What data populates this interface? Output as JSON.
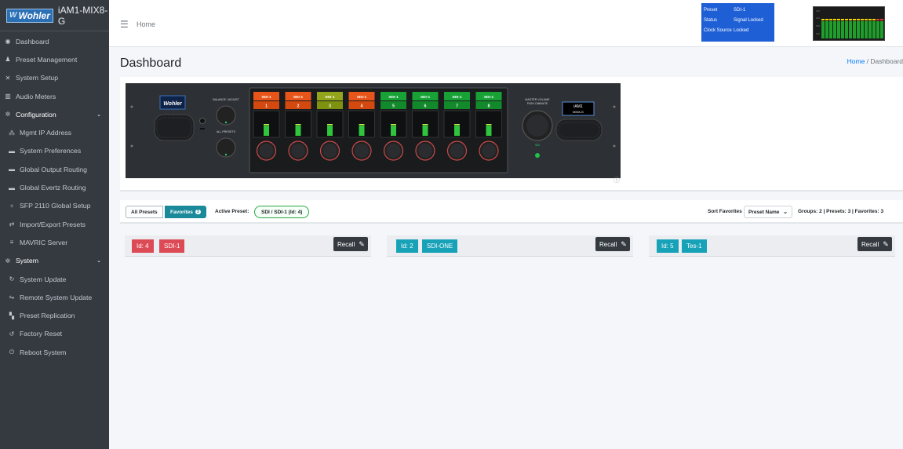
{
  "brand": {
    "logo_text": "Wohler",
    "device_name": "iAM1-MIX8-G"
  },
  "sidebar": {
    "items": [
      {
        "label": "Dashboard",
        "icon": "dashboard-icon",
        "glyph": "◉"
      },
      {
        "label": "Preset Management",
        "icon": "user-settings-icon",
        "glyph": "♟"
      },
      {
        "label": "System Setup",
        "icon": "tools-icon",
        "glyph": "✕"
      },
      {
        "label": "Audio Meters",
        "icon": "chart-icon",
        "glyph": "▥"
      },
      {
        "label": "Configuration",
        "icon": "gear-icon",
        "glyph": "✲"
      },
      {
        "label": "Mgmt IP Address",
        "icon": "network-icon",
        "glyph": "⁂"
      },
      {
        "label": "System Preferences",
        "icon": "keyboard-icon",
        "glyph": "▬"
      },
      {
        "label": "Global Output Routing",
        "icon": "keyboard-icon",
        "glyph": "▬"
      },
      {
        "label": "Global Evertz Routing",
        "icon": "keyboard-icon",
        "glyph": "▬"
      },
      {
        "label": "SFP 2110 Global Setup",
        "icon": "plug-icon",
        "glyph": "♆"
      },
      {
        "label": "Import/Export Presets",
        "icon": "swap-icon",
        "glyph": "⇄"
      },
      {
        "label": "MAVRIC Server",
        "icon": "server-icon",
        "glyph": "≡"
      },
      {
        "label": "System",
        "icon": "gears-icon",
        "glyph": "✲"
      },
      {
        "label": "System Update",
        "icon": "sync-icon",
        "glyph": "↻"
      },
      {
        "label": "Remote System Update",
        "icon": "remote-icon",
        "glyph": "⇋"
      },
      {
        "label": "Preset Replication",
        "icon": "copy-icon",
        "glyph": "▚"
      },
      {
        "label": "Factory Reset",
        "icon": "undo-icon",
        "glyph": "↺"
      },
      {
        "label": "Reboot System",
        "icon": "power-icon",
        "glyph": "⏻"
      }
    ]
  },
  "topbar": {
    "breadcrumb": "Home"
  },
  "status": {
    "rows": [
      {
        "k": "Preset",
        "v": "SDI-1"
      },
      {
        "k": "Status",
        "v": "Signal Locked"
      },
      {
        "k": "Clock Source",
        "v": "Locked"
      }
    ]
  },
  "page": {
    "title": "Dashboard",
    "crumb_home": "Home",
    "crumb_current": "Dashboard"
  },
  "device": {
    "logo": "Wohler",
    "balance_label": "BALANCE / ADJUST",
    "all_presets_label": "ALL PRESETS",
    "master_label": "MASTER VOLUME",
    "master_sub": "PUSH: DIM/MUTE",
    "master_value": "SDI",
    "screen_line1": "iAM1",
    "screen_line2": "MIX8-G",
    "channels": [
      {
        "src": "SDI-1",
        "num": "1",
        "color": "#e8551a",
        "numcolor": "#d4490f"
      },
      {
        "src": "SDI-1",
        "num": "2",
        "color": "#e8551a",
        "numcolor": "#d4490f"
      },
      {
        "src": "SDI-1",
        "num": "3",
        "color": "#93a51a",
        "numcolor": "#7f9210"
      },
      {
        "src": "SDI-1",
        "num": "4",
        "color": "#e8551a",
        "numcolor": "#d4490f"
      },
      {
        "src": "SDI-1",
        "num": "5",
        "color": "#18a236",
        "numcolor": "#128a2b"
      },
      {
        "src": "SDI-1",
        "num": "6",
        "color": "#18a236",
        "numcolor": "#128a2b"
      },
      {
        "src": "SDI-1",
        "num": "7",
        "color": "#18a236",
        "numcolor": "#128a2b"
      },
      {
        "src": "SDI-1",
        "num": "8",
        "color": "#18a236",
        "numcolor": "#128a2b"
      }
    ]
  },
  "tabs": {
    "all": "All Presets",
    "favorites": "Favorites",
    "fav_count": "3",
    "active_label": "Active Preset:",
    "active_value": "SDI / SDI-1 (Id: 4)"
  },
  "sort": {
    "label": "Sort Favorites",
    "value": "Preset Name",
    "counts": "Groups: 2 | Presets: 3 | Favorites: 3"
  },
  "presets": [
    {
      "id": "Id: 4",
      "name": "SDI-1",
      "color": "#dc4a55",
      "recall": "Recall"
    },
    {
      "id": "Id: 2",
      "name": "SDI-ONE",
      "color": "#17a2b8",
      "recall": "Recall"
    },
    {
      "id": "Id: 5",
      "name": "Tes-1",
      "color": "#17a2b8",
      "recall": "Recall"
    }
  ]
}
